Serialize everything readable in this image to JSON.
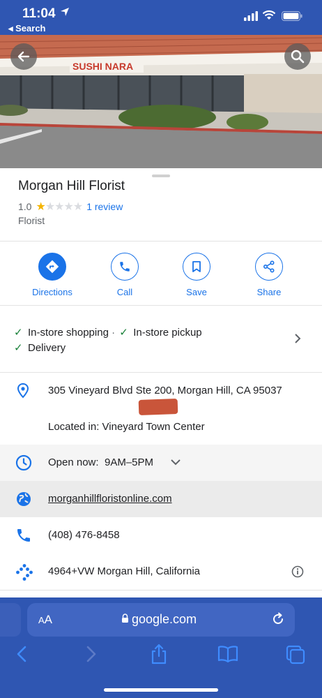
{
  "status_bar": {
    "time": "11:04",
    "back_app": "◂ Search"
  },
  "place": {
    "name": "Morgan Hill Florist",
    "rating": "1.0",
    "rating_stars": 1,
    "reviews": "1 review",
    "category": "Florist",
    "photo_sign": "SUSHI NARA"
  },
  "actions": [
    {
      "label": "Directions",
      "icon": "directions-icon"
    },
    {
      "label": "Call",
      "icon": "phone-icon"
    },
    {
      "label": "Save",
      "icon": "bookmark-icon"
    },
    {
      "label": "Share",
      "icon": "share-icon"
    }
  ],
  "services": {
    "item1": "In-store shopping",
    "separator": "·",
    "item2": "In-store pickup",
    "item3": "Delivery"
  },
  "details": {
    "address": "305 Vineyard Blvd Ste 200, Morgan Hill, CA 95037",
    "located_in": "Located in: Vineyard Town Center",
    "hours_status": "Open now:",
    "hours": "9AM–5PM",
    "website": "morganhillfloristonline.com",
    "phone": "(408) 476-8458",
    "plus_code": "4964+VW Morgan Hill, California"
  },
  "safari": {
    "aa_small": "A",
    "aa_large": "A",
    "url": "google.com"
  },
  "colors": {
    "accent": "#1a73e8",
    "safari_bar": "#2f56b2",
    "check_green": "#188038",
    "star": "#f4b400"
  }
}
